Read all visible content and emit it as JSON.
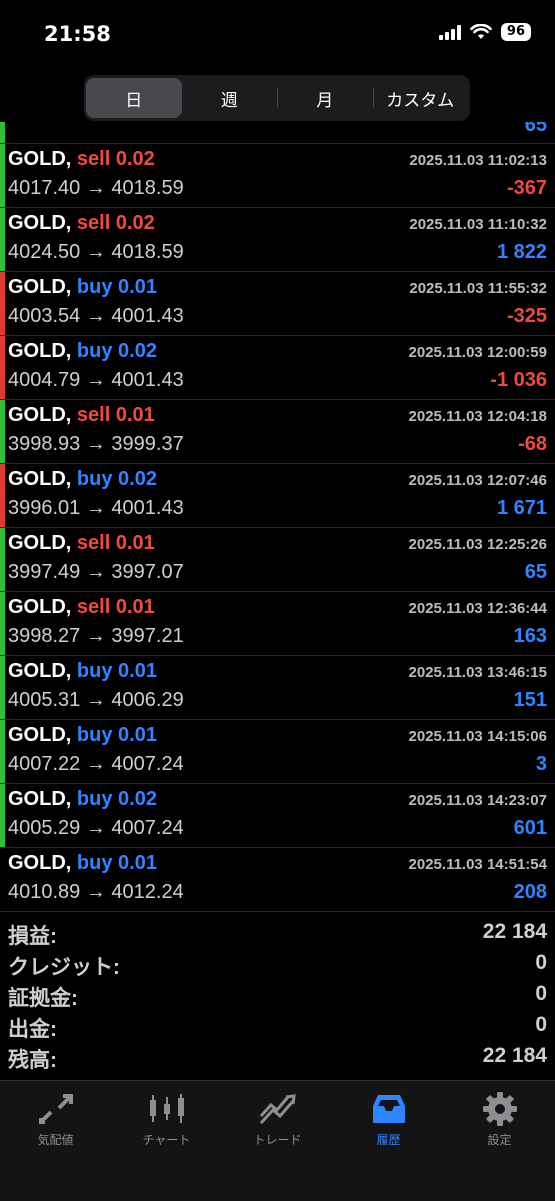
{
  "status": {
    "time": "21:58",
    "battery": "96"
  },
  "tabs": [
    "日",
    "週",
    "月",
    "カスタム"
  ],
  "partial_row": {
    "pnl": "65"
  },
  "rows": [
    {
      "sym": "GOLD,",
      "side": "sell",
      "vol": "0.02",
      "open": "4017.40",
      "close": "4018.59",
      "date": "2025.11.03 11:02:13",
      "pnl": "-367",
      "bar": "#2fbf3a"
    },
    {
      "sym": "GOLD,",
      "side": "sell",
      "vol": "0.02",
      "open": "4024.50",
      "close": "4018.59",
      "date": "2025.11.03 11:10:32",
      "pnl": "1 822",
      "bar": "#2fbf3a"
    },
    {
      "sym": "GOLD,",
      "side": "buy",
      "vol": "0.01",
      "open": "4003.54",
      "close": "4001.43",
      "date": "2025.11.03 11:55:32",
      "pnl": "-325",
      "bar": "#e03a33"
    },
    {
      "sym": "GOLD,",
      "side": "buy",
      "vol": "0.02",
      "open": "4004.79",
      "close": "4001.43",
      "date": "2025.11.03 12:00:59",
      "pnl": "-1 036",
      "bar": "#e03a33"
    },
    {
      "sym": "GOLD,",
      "side": "sell",
      "vol": "0.01",
      "open": "3998.93",
      "close": "3999.37",
      "date": "2025.11.03 12:04:18",
      "pnl": "-68",
      "bar": "#2fbf3a"
    },
    {
      "sym": "GOLD,",
      "side": "buy",
      "vol": "0.02",
      "open": "3996.01",
      "close": "4001.43",
      "date": "2025.11.03 12:07:46",
      "pnl": "1 671",
      "bar": "#e03a33"
    },
    {
      "sym": "GOLD,",
      "side": "sell",
      "vol": "0.01",
      "open": "3997.49",
      "close": "3997.07",
      "date": "2025.11.03 12:25:26",
      "pnl": "65",
      "bar": "#2fbf3a"
    },
    {
      "sym": "GOLD,",
      "side": "sell",
      "vol": "0.01",
      "open": "3998.27",
      "close": "3997.21",
      "date": "2025.11.03 12:36:44",
      "pnl": "163",
      "bar": "#2fbf3a"
    },
    {
      "sym": "GOLD,",
      "side": "buy",
      "vol": "0.01",
      "open": "4005.31",
      "close": "4006.29",
      "date": "2025.11.03 13:46:15",
      "pnl": "151",
      "bar": "#2fbf3a"
    },
    {
      "sym": "GOLD,",
      "side": "buy",
      "vol": "0.01",
      "open": "4007.22",
      "close": "4007.24",
      "date": "2025.11.03 14:15:06",
      "pnl": "3",
      "bar": "#2fbf3a"
    },
    {
      "sym": "GOLD,",
      "side": "buy",
      "vol": "0.02",
      "open": "4005.29",
      "close": "4007.24",
      "date": "2025.11.03 14:23:07",
      "pnl": "601",
      "bar": "#2fbf3a"
    },
    {
      "sym": "GOLD,",
      "side": "buy",
      "vol": "0.01",
      "open": "4010.89",
      "close": "4012.24",
      "date": "2025.11.03 14:51:54",
      "pnl": "208",
      "bar": ""
    }
  ],
  "arrow": "→",
  "summary": [
    {
      "label": "損益:",
      "value": "22 184"
    },
    {
      "label": "クレジット:",
      "value": "0"
    },
    {
      "label": "証拠金:",
      "value": "0"
    },
    {
      "label": "出金:",
      "value": "0"
    },
    {
      "label": "残高:",
      "value": "22 184"
    }
  ],
  "tabbar": [
    {
      "label": "気配値",
      "icon": "quotes-icon"
    },
    {
      "label": "チャート",
      "icon": "chart-icon"
    },
    {
      "label": "トレード",
      "icon": "trade-icon"
    },
    {
      "label": "履歴",
      "icon": "history-icon",
      "active": true
    },
    {
      "label": "設定",
      "icon": "settings-icon"
    }
  ]
}
